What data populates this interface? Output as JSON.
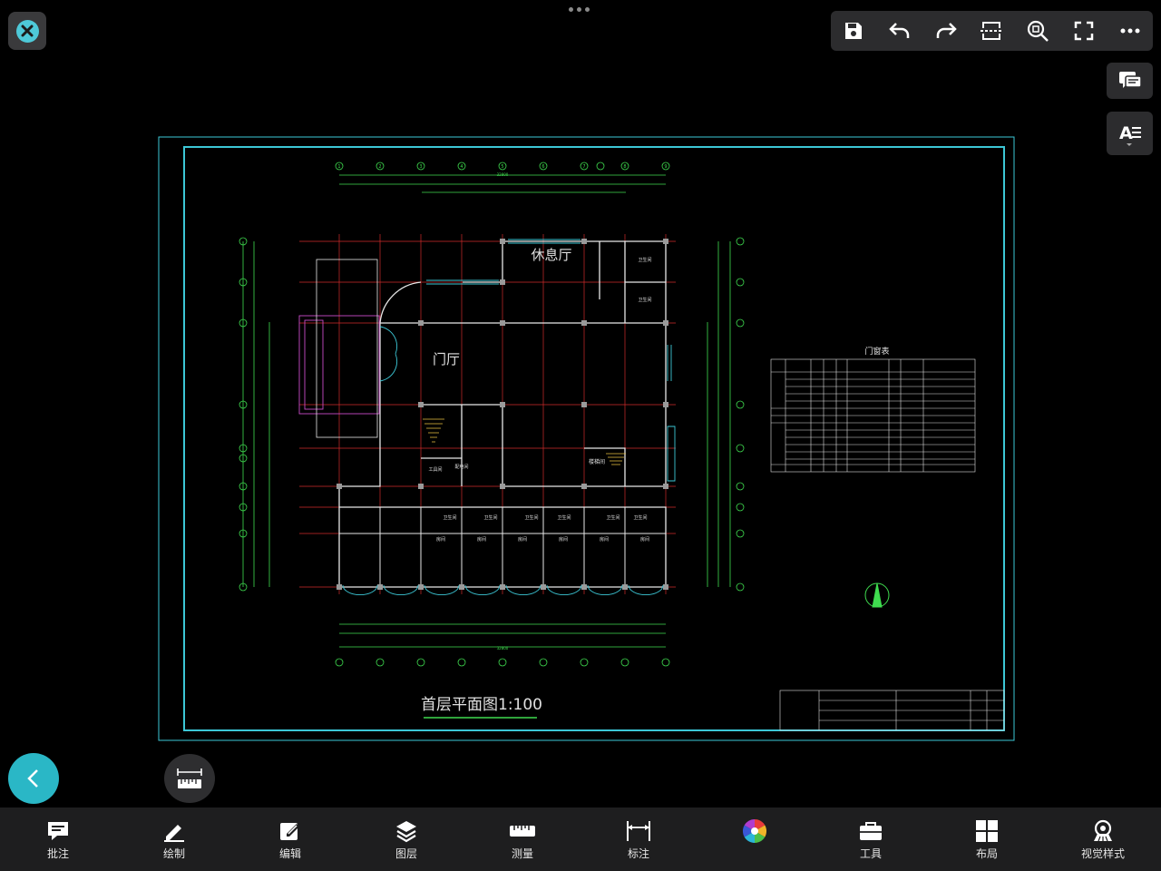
{
  "toolbar": {
    "icons": [
      "save-icon",
      "undo-icon",
      "redo-icon",
      "section-icon",
      "zoom-icon",
      "fullscreen-icon",
      "more-icon"
    ]
  },
  "side_panel": {
    "comment_icon": "comment-icon",
    "text_style_icon": "text-style-icon"
  },
  "drawing": {
    "title": "首层平面图1:100",
    "room_lounge": "休息厅",
    "room_lobby": "门厅",
    "door_window_table_title": "门窗表",
    "grid_top": [
      "1",
      "2",
      "3",
      "4",
      "5",
      "6",
      "7",
      "8",
      "9"
    ],
    "grid_side": [
      "K",
      "J",
      "H",
      "G",
      "F",
      "E",
      "D",
      "C",
      "B",
      "A"
    ],
    "total_dim": "32800",
    "rooms_toilet": "卫生间",
    "rooms_room": "房间",
    "room_stair": "楼梯间",
    "room_electric": "配电间",
    "room_tool": "工具间"
  },
  "bottom_bar": {
    "items": [
      {
        "label": "批注",
        "icon": "annotate-icon"
      },
      {
        "label": "绘制",
        "icon": "draw-icon"
      },
      {
        "label": "编辑",
        "icon": "edit-icon"
      },
      {
        "label": "图层",
        "icon": "layers-icon"
      },
      {
        "label": "测量",
        "icon": "measure-icon"
      },
      {
        "label": "标注",
        "icon": "dimension-icon"
      },
      {
        "label": "",
        "icon": "color-wheel-icon"
      },
      {
        "label": "工具",
        "icon": "toolbox-icon"
      },
      {
        "label": "布局",
        "icon": "layout-icon"
      },
      {
        "label": "视觉样式",
        "icon": "visual-style-icon"
      }
    ]
  }
}
